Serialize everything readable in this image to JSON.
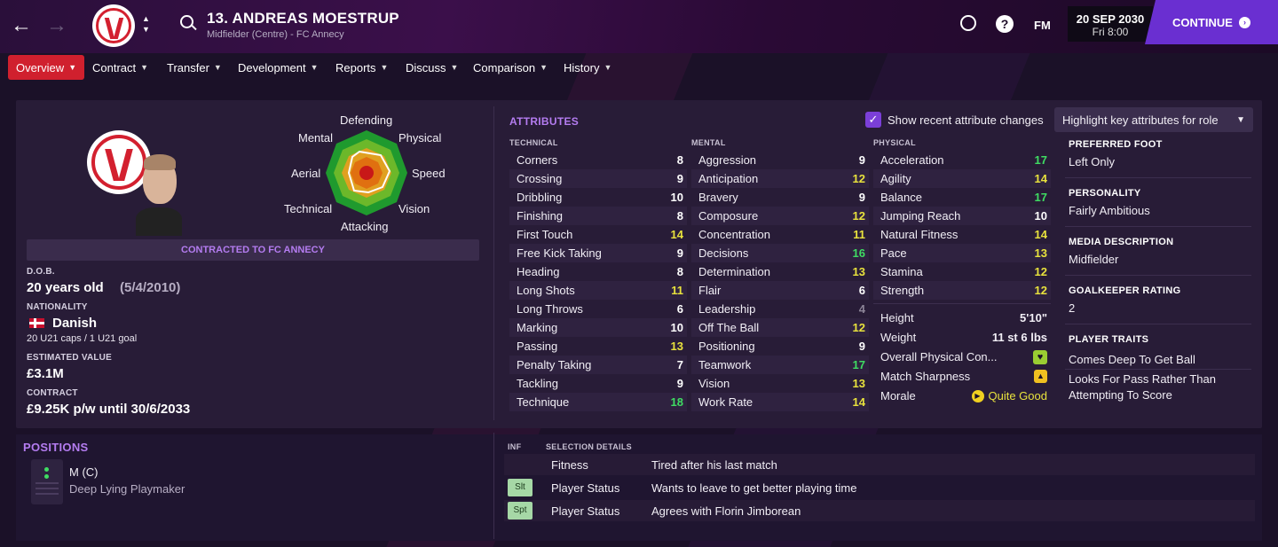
{
  "header": {
    "player_title": "13. ANDREAS MOESTRUP",
    "player_subtitle": "Midfielder (Centre) - FC Annecy",
    "date": "20 SEP 2030",
    "time": "Fri 8:00",
    "continue_label": "CONTINUE",
    "fm_label": "FM",
    "help_label": "?",
    "crest_year": "1927",
    "crest_name": "ANNECY"
  },
  "menu": [
    {
      "label": "Overview"
    },
    {
      "label": "Contract"
    },
    {
      "label": "Transfer"
    },
    {
      "label": "Development"
    },
    {
      "label": "Reports"
    },
    {
      "label": "Discuss"
    },
    {
      "label": "Comparison"
    },
    {
      "label": "History"
    }
  ],
  "profile": {
    "radar_labels": {
      "top": "Defending",
      "top_left": "Mental",
      "top_right": "Physical",
      "left": "Aerial",
      "right": "Speed",
      "bottom_left": "Technical",
      "bottom_right": "Vision",
      "bottom": "Attacking"
    },
    "contract_banner": "CONTRACTED TO FC ANNECY",
    "dob_label": "D.O.B.",
    "age": "20 years old",
    "dob": "(5/4/2010)",
    "nationality_label": "NATIONALITY",
    "nationality": "Danish",
    "caps": "20 U21 caps / 1 U21 goal",
    "value_label": "ESTIMATED VALUE",
    "value": "£3.1M",
    "contract_label": "CONTRACT",
    "contract": "£9.25K p/w until 30/6/2033"
  },
  "attributes": {
    "title": "ATTRIBUTES",
    "show_changes_label": "Show recent attribute changes",
    "highlight_dropdown": "Highlight key attributes for role",
    "technical_header": "TECHNICAL",
    "mental_header": "MENTAL",
    "physical_header": "PHYSICAL",
    "technical": [
      {
        "name": "Corners",
        "value": "8",
        "c": "white"
      },
      {
        "name": "Crossing",
        "value": "9",
        "c": "white"
      },
      {
        "name": "Dribbling",
        "value": "10",
        "c": "white"
      },
      {
        "name": "Finishing",
        "value": "8",
        "c": "white"
      },
      {
        "name": "First Touch",
        "value": "14",
        "c": "yellow"
      },
      {
        "name": "Free Kick Taking",
        "value": "9",
        "c": "white"
      },
      {
        "name": "Heading",
        "value": "8",
        "c": "white"
      },
      {
        "name": "Long Shots",
        "value": "11",
        "c": "yellow"
      },
      {
        "name": "Long Throws",
        "value": "6",
        "c": "white"
      },
      {
        "name": "Marking",
        "value": "10",
        "c": "white"
      },
      {
        "name": "Passing",
        "value": "13",
        "c": "yellow"
      },
      {
        "name": "Penalty Taking",
        "value": "7",
        "c": "white"
      },
      {
        "name": "Tackling",
        "value": "9",
        "c": "white"
      },
      {
        "name": "Technique",
        "value": "18",
        "c": "green"
      }
    ],
    "mental": [
      {
        "name": "Aggression",
        "value": "9",
        "c": "white"
      },
      {
        "name": "Anticipation",
        "value": "12",
        "c": "yellow"
      },
      {
        "name": "Bravery",
        "value": "9",
        "c": "white"
      },
      {
        "name": "Composure",
        "value": "12",
        "c": "yellow"
      },
      {
        "name": "Concentration",
        "value": "11",
        "c": "yellow"
      },
      {
        "name": "Decisions",
        "value": "16",
        "c": "green"
      },
      {
        "name": "Determination",
        "value": "13",
        "c": "yellow"
      },
      {
        "name": "Flair",
        "value": "6",
        "c": "white"
      },
      {
        "name": "Leadership",
        "value": "4",
        "c": "grey"
      },
      {
        "name": "Off The Ball",
        "value": "12",
        "c": "yellow"
      },
      {
        "name": "Positioning",
        "value": "9",
        "c": "white"
      },
      {
        "name": "Teamwork",
        "value": "17",
        "c": "green"
      },
      {
        "name": "Vision",
        "value": "13",
        "c": "yellow"
      },
      {
        "name": "Work Rate",
        "value": "14",
        "c": "yellow"
      }
    ],
    "physical": [
      {
        "name": "Acceleration",
        "value": "17",
        "c": "green"
      },
      {
        "name": "Agility",
        "value": "14",
        "c": "yellow"
      },
      {
        "name": "Balance",
        "value": "17",
        "c": "green"
      },
      {
        "name": "Jumping Reach",
        "value": "10",
        "c": "white"
      },
      {
        "name": "Natural Fitness",
        "value": "14",
        "c": "yellow"
      },
      {
        "name": "Pace",
        "value": "13",
        "c": "yellow"
      },
      {
        "name": "Stamina",
        "value": "12",
        "c": "yellow"
      },
      {
        "name": "Strength",
        "value": "12",
        "c": "yellow"
      }
    ],
    "extra": {
      "height_label": "Height",
      "height": "5'10\"",
      "weight_label": "Weight",
      "weight": "11 st 6 lbs",
      "condition_label": "Overall Physical Con...",
      "sharpness_label": "Match Sharpness",
      "morale_label": "Morale",
      "morale": "Quite Good"
    }
  },
  "info": {
    "foot_label": "PREFERRED FOOT",
    "foot": "Left Only",
    "personality_label": "PERSONALITY",
    "personality": "Fairly Ambitious",
    "media_label": "MEDIA DESCRIPTION",
    "media": "Midfielder",
    "gk_label": "GOALKEEPER RATING",
    "gk": "2",
    "traits_label": "PLAYER TRAITS",
    "trait1": "Comes Deep To Get Ball",
    "trait2a": "Looks For Pass Rather Than",
    "trait2b": "Attempting To Score"
  },
  "positions": {
    "title": "POSITIONS",
    "position": "M (C)",
    "role": "Deep Lying Playmaker"
  },
  "selection": {
    "inf_header": "INF",
    "details_header": "SELECTION DETAILS",
    "rows": [
      {
        "badge": "",
        "type": "Fitness",
        "detail": "Tired after his last match"
      },
      {
        "badge": "Slt",
        "type": "Player Status",
        "detail": "Wants to leave to get better playing time"
      },
      {
        "badge": "Spt",
        "type": "Player Status",
        "detail": "Agrees with Florin Jimborean"
      }
    ]
  },
  "colors": {
    "accent_red": "#d0202e",
    "accent_purple": "#6a2fd1",
    "value_green": "#3fdc62",
    "value_yellow": "#e8e23d"
  }
}
